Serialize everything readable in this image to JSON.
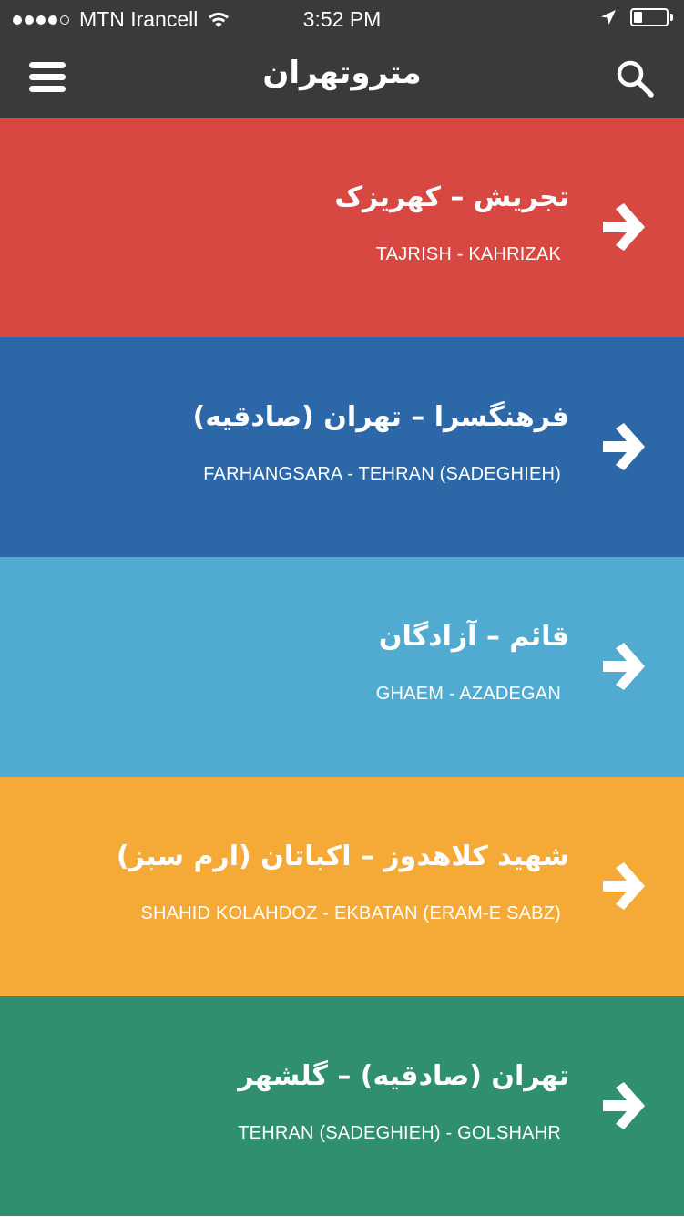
{
  "status_bar": {
    "carrier": "MTN Irancell",
    "time": "3:52 PM",
    "signal_bars": 4,
    "signal_total": 5,
    "battery_level": 0.25,
    "icons": [
      "wifi-icon",
      "location-arrow-icon",
      "battery-icon"
    ]
  },
  "header": {
    "title": "متروتهران",
    "menu_icon": "hamburger-menu-icon",
    "search_icon": "search-icon",
    "background": "#3a3a3a"
  },
  "lines": [
    {
      "name_fa": "تجریش – کهریزک",
      "name_en": "TAJRISH - KAHRIZAK",
      "color": "#d84842",
      "icon": "arrow-right-icon"
    },
    {
      "name_fa": "فرهنگسرا – تهران (صادقیه)",
      "name_en": "FARHANGSARA - TEHRAN (SADEGHIEH)",
      "color": "#2c68a8",
      "icon": "arrow-right-icon"
    },
    {
      "name_fa": "قائم – آزادگان",
      "name_en": "GHAEM - AZADEGAN",
      "color": "#51abd1",
      "icon": "arrow-right-icon"
    },
    {
      "name_fa": "شهید کلاهدوز – اکباتان (ارم سبز)",
      "name_en": "SHAHID KOLAHDOZ - EKBATAN (ERAM-E SABZ)",
      "color": "#f5aa38",
      "icon": "arrow-right-icon"
    },
    {
      "name_fa": "تهران (صادقیه) – گلشهر",
      "name_en": "TEHRAN (SADEGHIEH) - GOLSHAHR",
      "color": "#2f8f6e",
      "icon": "arrow-right-icon"
    }
  ]
}
